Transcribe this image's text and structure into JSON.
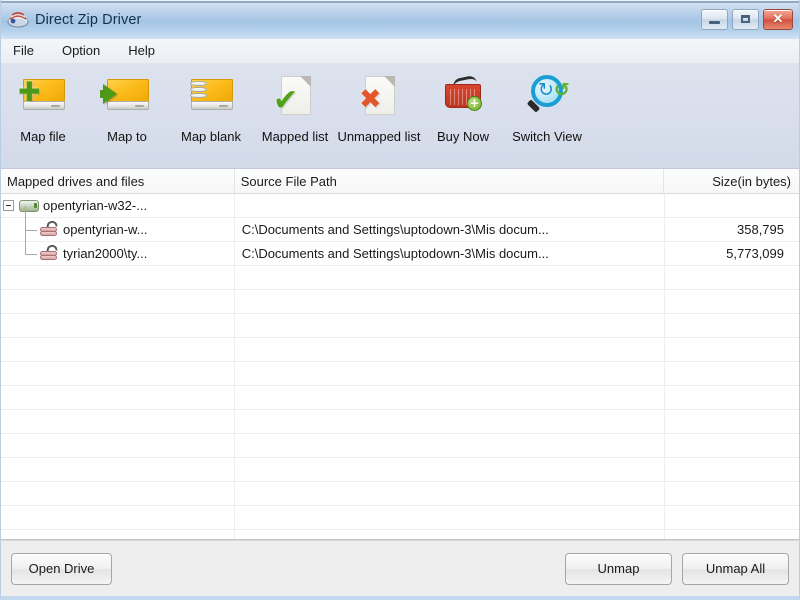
{
  "window": {
    "title": "Direct Zip Driver",
    "app_icon": "zip-archive-icon",
    "controls": {
      "minimize": "minimize-icon",
      "maximize": "maximize-icon",
      "close": "✕"
    }
  },
  "menubar": {
    "items": [
      {
        "label": "File"
      },
      {
        "label": "Option"
      },
      {
        "label": "Help"
      }
    ]
  },
  "toolbar": {
    "buttons": [
      {
        "label": "Map file",
        "icon": "drive-add-icon"
      },
      {
        "label": "Map to",
        "icon": "drive-arrow-icon"
      },
      {
        "label": "Map blank",
        "icon": "drive-blank-icon"
      },
      {
        "label": "Mapped list",
        "icon": "document-check-icon"
      },
      {
        "label": "Unmapped list",
        "icon": "document-x-icon"
      },
      {
        "label": "Buy Now",
        "icon": "shopping-basket-add-icon"
      },
      {
        "label": "Switch View",
        "icon": "magnifier-refresh-icon"
      }
    ]
  },
  "grid": {
    "columns": [
      {
        "key": "name",
        "label": "Mapped drives and files"
      },
      {
        "key": "path",
        "label": "Source File Path"
      },
      {
        "key": "size",
        "label": "Size(in bytes)"
      }
    ],
    "rows": [
      {
        "type": "drive",
        "expanded": true,
        "name": "opentyrian-w32-...",
        "path": "",
        "size": "",
        "icon": "drive-icon"
      },
      {
        "type": "file",
        "name": "opentyrian-w...",
        "path": "C:\\Documents and Settings\\uptodown-3\\Mis docum...",
        "size": "358,795",
        "icon": "zip-file-icon"
      },
      {
        "type": "file",
        "name": "tyrian2000\\ty...",
        "path": "C:\\Documents and Settings\\uptodown-3\\Mis docum...",
        "size": "5,773,099",
        "icon": "zip-file-icon"
      }
    ],
    "empty_row_count": 12
  },
  "footer": {
    "open_drive_label": "Open Drive",
    "unmap_label": "Unmap",
    "unmap_all_label": "Unmap All"
  },
  "colors": {
    "titlebar_accent": "#a3c4e4",
    "toolbar_bg": "#d8deec",
    "drive_icon": "#f0a905",
    "check_green": "#53a11a",
    "x_orange": "#e2562a",
    "basket_red": "#c0351f",
    "magnifier_blue": "#1a9ed4"
  }
}
